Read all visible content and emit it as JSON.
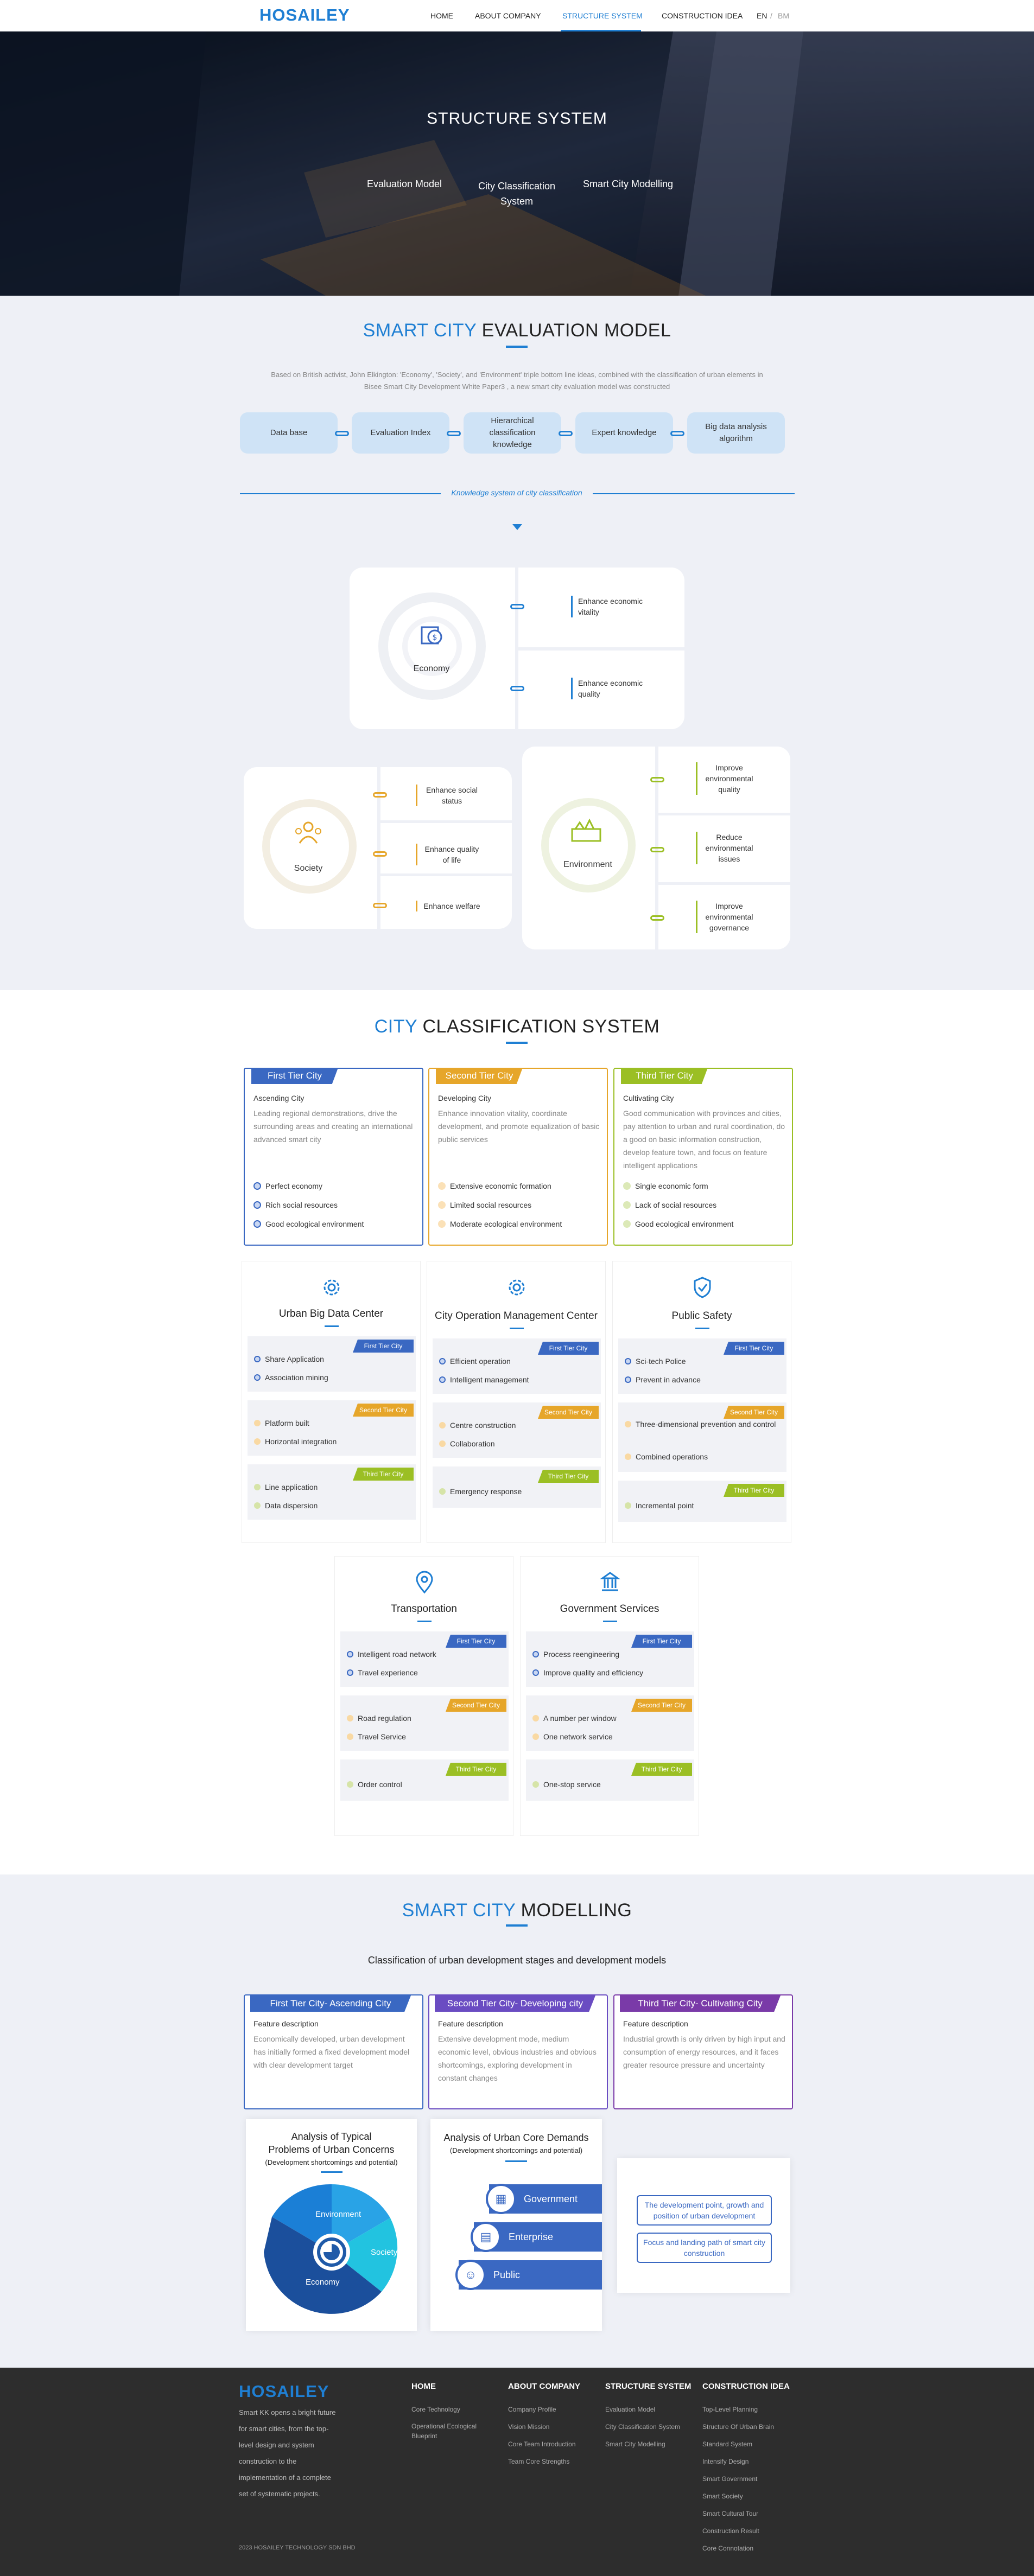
{
  "nav": {
    "logo": "HOSAILEY",
    "links": [
      "HOME",
      "ABOUT COMPANY",
      "STRUCTURE SYSTEM",
      "CONSTRUCTION IDEA"
    ],
    "active": "STRUCTURE SYSTEM",
    "lang_en": "EN",
    "lang_sep": "/",
    "lang_bm": "BM"
  },
  "hero": {
    "title": "STRUCTURE SYSTEM",
    "tabs": [
      "Evaluation Model",
      "City Classification System",
      "Smart City Modelling"
    ]
  },
  "evaluation": {
    "title_accent": "SMART CITY",
    "title_rest": " EVALUATION MODEL",
    "intro_1": "Based on British activist, John Elkington: 'Economy', 'Society', and 'Environment' triple bottom line ideas, combined with the classification of urban elements in",
    "intro_2": "Bisee Smart City Development White Paper3 , a new smart city evaluation model was constructed",
    "flow": [
      "Data base",
      "Evaluation Index",
      "Hierarchical classification knowledge",
      "Expert knowledge",
      "Big data analysis algorithm"
    ],
    "knowledge_label": "Knowledge system of city classification",
    "economy": {
      "label": "Economy",
      "benefits": [
        "Enhance economic vitality",
        "Enhance economic quality"
      ]
    },
    "society": {
      "label": "Society",
      "benefits": [
        "Enhance social status",
        "Enhance quality of life",
        "Enhance welfare"
      ]
    },
    "environment": {
      "label": "Environment",
      "benefits": [
        "Improve environmental quality",
        "Reduce environmental issues",
        "Improve environmental governance"
      ]
    }
  },
  "classification": {
    "title_accent": "CITY",
    "title_rest": " CLASSIFICATION SYSTEM",
    "tiers": [
      {
        "tag": "First Tier City",
        "sub": "Ascending City",
        "desc": "Leading regional demonstrations, drive the surrounding areas and creating an international advanced smart city",
        "items": [
          "Perfect economy",
          "Rich social resources",
          "Good ecological environment"
        ],
        "color": "#3a68c2"
      },
      {
        "tag": "Second Tier City",
        "sub": "Developing City",
        "desc": "Enhance innovation vitality, coordinate development, and promote equalization of basic public services",
        "items": [
          "Extensive economic formation",
          "Limited social resources",
          "Moderate ecological environment"
        ],
        "color": "#e6a62a"
      },
      {
        "tag": "Third Tier City",
        "sub": "Cultivating City",
        "desc": "Good communication with provinces and cities, pay attention to urban and rural coordination, do a good on basic information construction, develop feature town, and focus on feature intelligent applications",
        "items": [
          "Single economic form",
          "Lack of social resources",
          "Good ecological environment"
        ],
        "color": "#9bbf24"
      }
    ],
    "tier_tags": [
      "First Tier City",
      "Second Tier City",
      "Third Tier City"
    ],
    "centers": [
      {
        "title": "Urban Big Data Center",
        "icon": "gear-icon",
        "t1": [
          "Share Application",
          "Association mining"
        ],
        "t2": [
          "Platform built",
          "Horizontal integration"
        ],
        "t3": [
          "Line application",
          "Data dispersion"
        ]
      },
      {
        "title": "City Operation Management Center",
        "icon": "gear-icon",
        "t1": [
          "Efficient operation",
          "Intelligent management"
        ],
        "t2": [
          "Centre construction",
          "Collaboration"
        ],
        "t3": [
          "Emergency response"
        ]
      },
      {
        "title": "Public Safety",
        "icon": "shield-icon",
        "t1": [
          "Sci-tech Police",
          "Prevent in advance"
        ],
        "t2": [
          "Three-dimensional prevention and control",
          "Combined operations"
        ],
        "t3": [
          "Incremental point"
        ]
      },
      {
        "title": "Transportation",
        "icon": "location-icon",
        "t1": [
          "Intelligent road network",
          "Travel experience"
        ],
        "t2": [
          "Road regulation",
          "Travel Service"
        ],
        "t3": [
          "Order control"
        ]
      },
      {
        "title": "Government Services",
        "icon": "government-icon",
        "t1": [
          "Process reengineering",
          "Improve quality and efficiency"
        ],
        "t2": [
          "A number per window",
          "One network service"
        ],
        "t3": [
          "One-stop service"
        ]
      }
    ]
  },
  "modelling": {
    "title_accent": "SMART CITY",
    "title_rest": " MODELLING",
    "subtitle": "Classification of urban development stages and development models",
    "feature_label": "Feature description",
    "cards": [
      {
        "head": "First Tier City- Ascending City",
        "text": "Economically developed, urban development has initially formed a fixed development model with clear development target",
        "color": "#3a68c2"
      },
      {
        "head": "Second Tier City- Developing city",
        "text": "Extensive development mode, medium economic level, obvious industries and obvious shortcomings, exploring development in constant changes",
        "color": "#6a4cc2"
      },
      {
        "head": "Third Tier City- Cultivating City",
        "text": "Industrial growth is only driven by high input and consumption of energy resources, and it faces greater resource pressure and uncertainty",
        "color": "#7a3aa8"
      }
    ],
    "analysis1": {
      "title_1": "Analysis of Typical",
      "title_2": "Problems of Urban Concerns",
      "sub": "(Development shortcomings and potential)",
      "segments": [
        "Environment",
        "Society",
        "Economy"
      ]
    },
    "analysis2": {
      "title": "Analysis of Urban Core Demands",
      "sub": "(Development shortcomings and potential)",
      "demands": [
        "Government",
        "Enterprise",
        "Public"
      ]
    },
    "boxes": [
      "The development point, growth and position of urban development",
      "Focus and landing path of smart city construction"
    ]
  },
  "footer": {
    "logo": "HOSAILEY",
    "about": "Smart KK opens a bright future for smart cities, from the top-level design and system construction to the implementation of a complete set of systematic projects.",
    "copyright": "2023 HOSAILEY TECHNOLOGY SDN BHD",
    "cols": [
      {
        "head": "HOME",
        "links": [
          "Core Technology",
          "Operational Ecological Blueprint"
        ]
      },
      {
        "head": "ABOUT COMPANY",
        "links": [
          "Company Profile",
          "Vision Mission",
          "Core Team Introduction",
          "Team Core Strengths"
        ]
      },
      {
        "head": "STRUCTURE SYSTEM",
        "links": [
          "Evaluation Model",
          "City Classification System",
          "Smart City Modelling"
        ]
      },
      {
        "head": "CONSTRUCTION IDEA",
        "links": [
          "Top-Level Planning",
          "Structure Of Urban Brain",
          "Standard System",
          "Intensify Design",
          "Smart Government",
          "Smart Society",
          "Smart Cultural Tour",
          "Construction Result",
          "Core Connotation"
        ]
      }
    ]
  }
}
